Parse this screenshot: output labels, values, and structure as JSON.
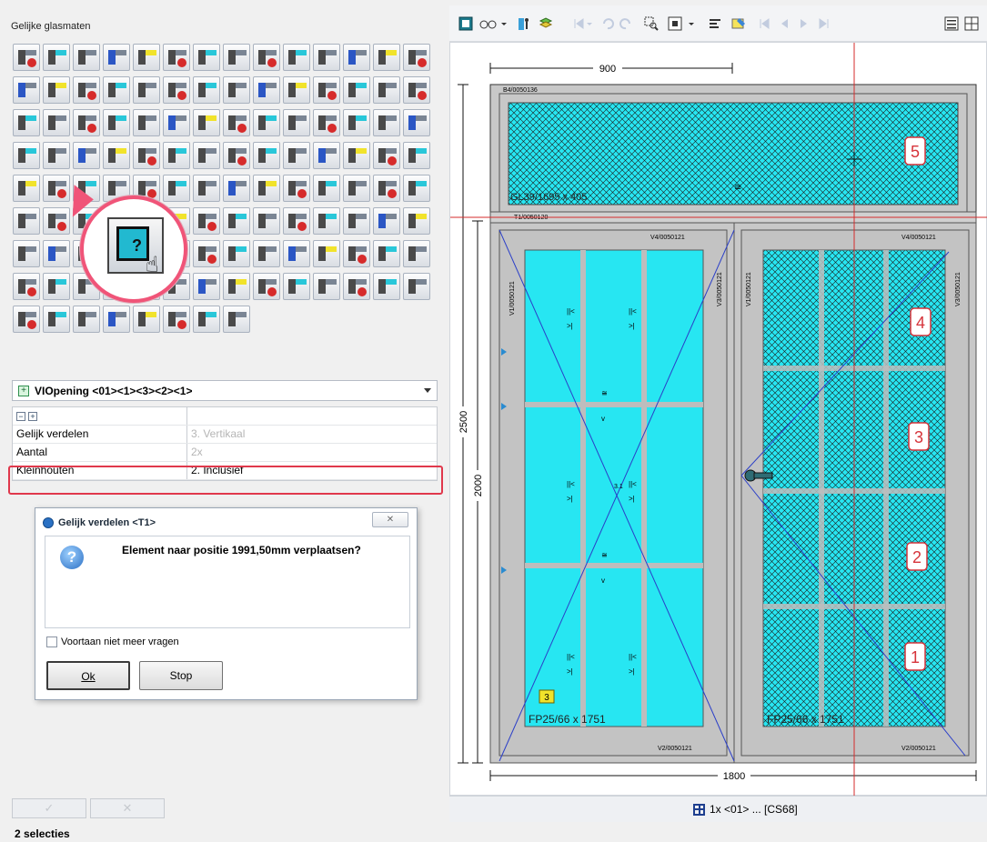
{
  "panel": {
    "title": "Gelijke glasmaten"
  },
  "dropdown": {
    "value": "VIOpening <01><1><3><2><1>"
  },
  "properties": {
    "rows": [
      {
        "label": "Gelijk verdelen",
        "value": "3. Vertikaal",
        "dim": true
      },
      {
        "label": "Aantal",
        "value": "2x",
        "dim": true
      },
      {
        "label": "Kleinhouten",
        "value": "2. Inclusief",
        "dim": false
      }
    ]
  },
  "dialog": {
    "title": "Gelijk verdelen <T1>",
    "message": "Element naar positie 1991,50mm verplaatsen?",
    "checkbox_label": "Voortaan niet meer vragen",
    "ok_label": "Ok",
    "stop_label": "Stop"
  },
  "bottom_buttons": {
    "accept": "✓",
    "cancel": "✕"
  },
  "status_left": "2 selecties",
  "status_right": "1x <01> ... [CS68]",
  "drawing": {
    "dim_top": "900",
    "dim_bottom": "1800",
    "dim_left_outer": "2500",
    "dim_left_inner": "2000",
    "top_panel_code": "B4/0050136",
    "top_panel_glass": "GL39/1695 x 405",
    "transom_code": "T1/0050120",
    "left_sash_top": "V4/0050121",
    "right_sash_top": "V4/0050121",
    "left_sash_side": "V1/0050121",
    "mid_left_side": "V3/0050121",
    "mid_right_side": "V1/0050121",
    "right_sash_side": "V3/0050121",
    "left_glass": "FP25/66  x 1751",
    "right_glass": "FP25/66  x 1751",
    "left_bottom_code": "V2/0050121",
    "right_bottom_code": "V2/0050121",
    "handle_center_label": "3.1",
    "bar_marker_a": "||<",
    "bar_marker_b": ">|",
    "bar_marker_t": "v",
    "bar_marker_z": "≅",
    "callout_labels": [
      "5",
      "4",
      "3",
      "2",
      "1"
    ],
    "yellow_tag": "3"
  },
  "colors": {
    "glass_cyan": "#27e6f2",
    "frame_gray": "#c8c8c8",
    "highlight_red": "#e0384c",
    "callout_red": "#d6333a",
    "line_blue": "#2a3ec8"
  }
}
